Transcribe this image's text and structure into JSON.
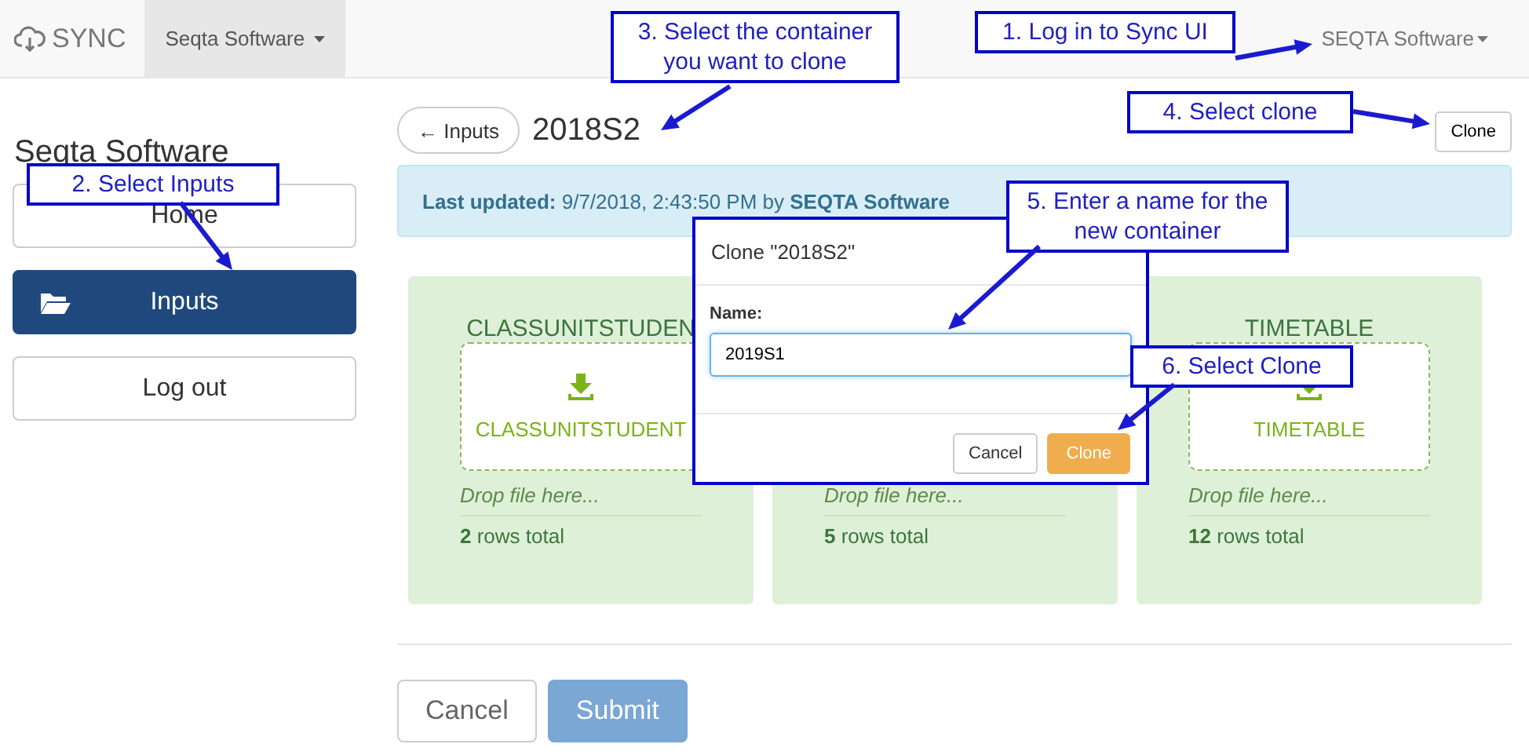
{
  "navbar": {
    "brand": "SYNC",
    "org_menu": "Seqta Software",
    "user_menu": "SEQTA Software"
  },
  "sidebar": {
    "title": "Seqta Software",
    "items": [
      {
        "label": "Home",
        "selected": false
      },
      {
        "label": "Inputs",
        "selected": true
      },
      {
        "label": "Log out",
        "selected": false
      }
    ]
  },
  "page": {
    "back_button": "← Inputs",
    "title": "2018S2",
    "clone_button": "Clone"
  },
  "alert": {
    "text": "**Last updated:** 9/7/2018, 2:43:50 PM by **SEQTA Software**"
  },
  "containers": [
    {
      "title": "CLASSUNITSTUDEN",
      "file_label": "CLASSUNITSTUDENT",
      "drop_hint": "Drop file here...",
      "rows_total": "**2** rows total"
    },
    {
      "drop_hint": "Drop file here...",
      "rows_total": "**5** rows total"
    },
    {
      "title": "TIMETABLE",
      "file_label": "TIMETABLE",
      "drop_hint": "Drop file here...",
      "rows_total": "**12** rows total"
    }
  ],
  "form_buttons": [
    "Cancel",
    "Submit"
  ],
  "modal": {
    "title": "Clone \"2018S2\"",
    "field_label": "Name:",
    "field_value": "2019S1",
    "buttons": [
      "Cancel",
      "Clone"
    ]
  },
  "annotations": [
    "1. Log in to Sync UI",
    "2. Select Inputs",
    "3. Select the container you want to clone",
    "4. Select clone",
    "5. Enter a name for the new container",
    "6. Select Clone"
  ]
}
